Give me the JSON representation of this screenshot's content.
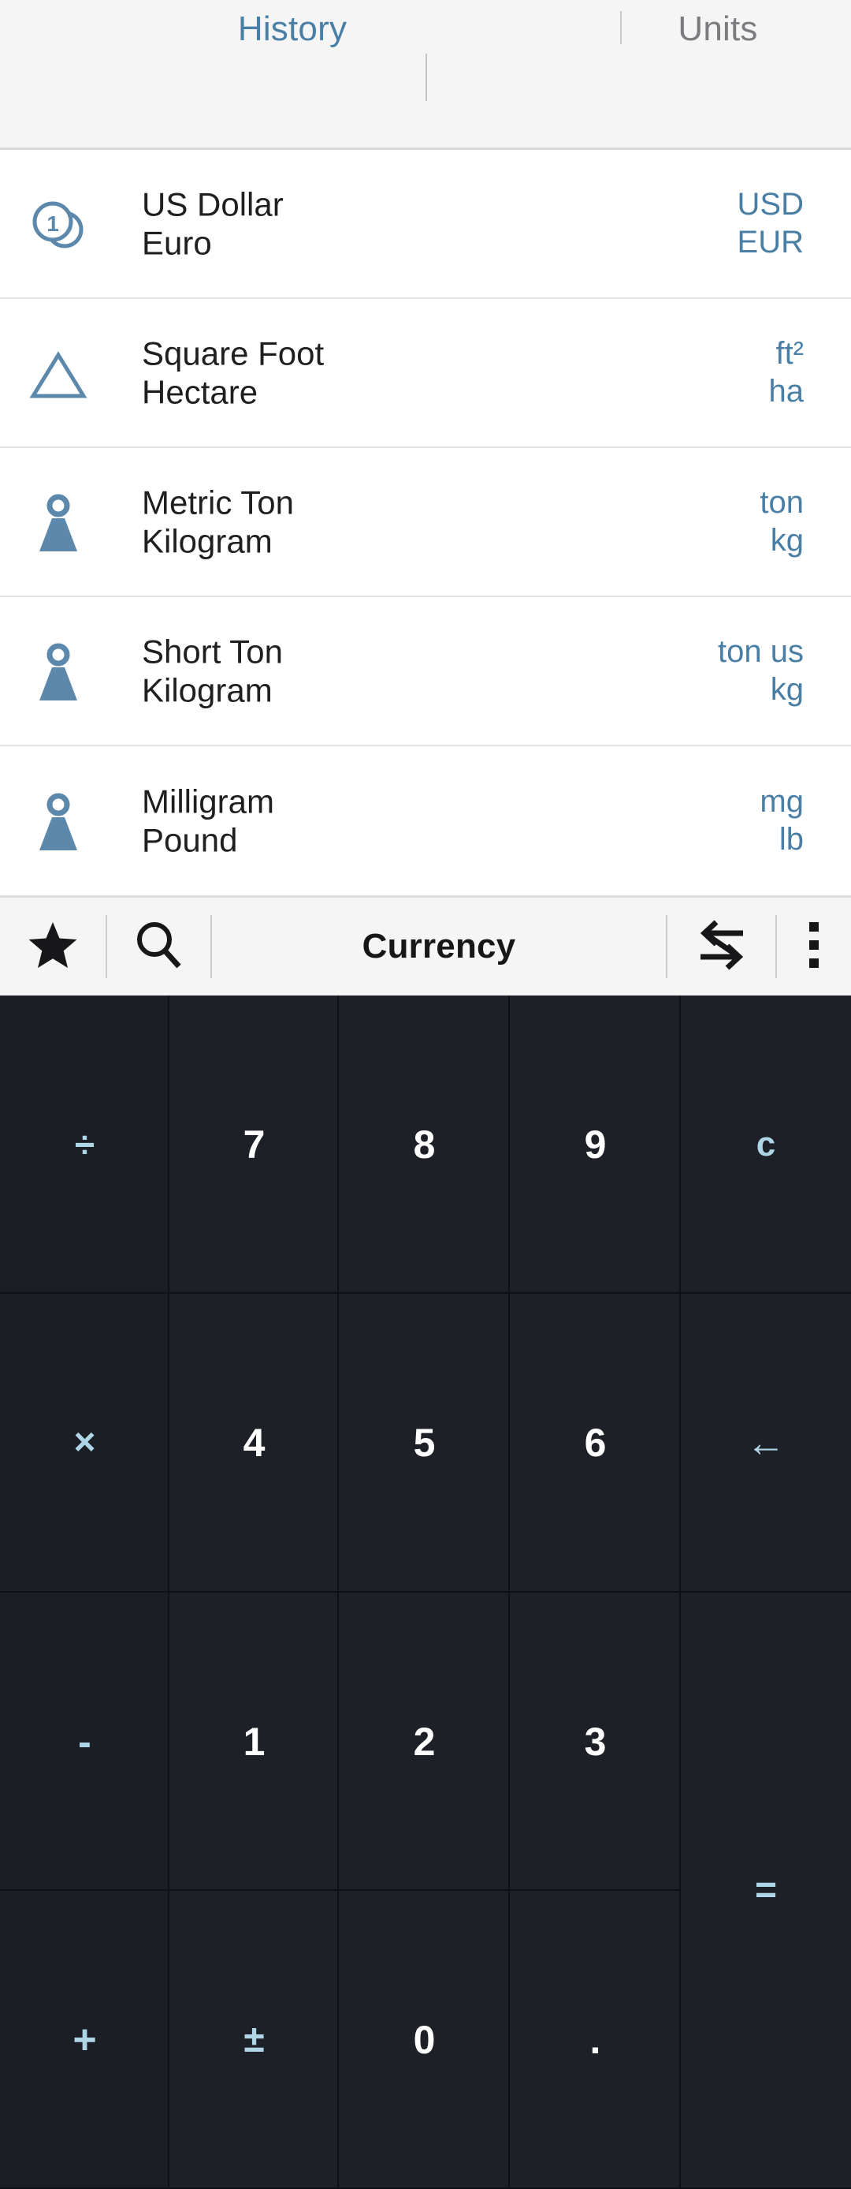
{
  "header": {
    "tabs": [
      {
        "label": "History",
        "active": true
      },
      {
        "label": "Units",
        "active": false
      }
    ],
    "active_color": "#4a7fa5",
    "inactive_color": "#7c7c80"
  },
  "list": {
    "rows": [
      {
        "icon": "coins-icon",
        "from_name": "US Dollar",
        "to_name": "Euro",
        "from_code": "USD",
        "to_code": "EUR"
      },
      {
        "icon": "triangle-area-icon",
        "from_name": "Square Foot",
        "to_name": "Hectare",
        "from_code": "ft²",
        "to_code": "ha"
      },
      {
        "icon": "weight-icon",
        "from_name": "Metric Ton",
        "to_name": "Kilogram",
        "from_code": "ton",
        "to_code": "kg"
      },
      {
        "icon": "weight-icon",
        "from_name": "Short Ton",
        "to_name": "Kilogram",
        "from_code": "ton us",
        "to_code": "kg"
      },
      {
        "icon": "weight-icon",
        "from_name": "Milligram",
        "to_name": "Pound",
        "from_code": "mg",
        "to_code": "lb"
      }
    ],
    "code_color": "#4a7fa5",
    "icon_color": "#5b88ab"
  },
  "toolbar": {
    "favorites_icon": "star-icon",
    "search_icon": "search-icon",
    "title": "Currency",
    "swap_icon": "swap-arrows-icon",
    "more_icon": "more-vertical-icon"
  },
  "keypad": {
    "accent_color": "#aed6e6",
    "digit_color": "#ffffff",
    "background": "#1d2026",
    "keys": [
      {
        "name": "divide",
        "label": "÷",
        "type": "op"
      },
      {
        "name": "seven",
        "label": "7",
        "type": "digit"
      },
      {
        "name": "eight",
        "label": "8",
        "type": "digit"
      },
      {
        "name": "nine",
        "label": "9",
        "type": "digit"
      },
      {
        "name": "clear",
        "label": "c",
        "type": "op"
      },
      {
        "name": "multiply",
        "label": "×",
        "type": "op"
      },
      {
        "name": "four",
        "label": "4",
        "type": "digit"
      },
      {
        "name": "five",
        "label": "5",
        "type": "digit"
      },
      {
        "name": "six",
        "label": "6",
        "type": "digit"
      },
      {
        "name": "backspace",
        "label": "←",
        "type": "op"
      },
      {
        "name": "minus",
        "label": "-",
        "type": "op"
      },
      {
        "name": "one",
        "label": "1",
        "type": "digit"
      },
      {
        "name": "two",
        "label": "2",
        "type": "digit"
      },
      {
        "name": "three",
        "label": "3",
        "type": "digit"
      },
      {
        "name": "equals",
        "label": "=",
        "type": "op"
      },
      {
        "name": "plus",
        "label": "+",
        "type": "op"
      },
      {
        "name": "plus-minus",
        "label": "±",
        "type": "op"
      },
      {
        "name": "zero",
        "label": "0",
        "type": "digit"
      },
      {
        "name": "decimal-point",
        "label": ".",
        "type": "digit"
      }
    ]
  }
}
